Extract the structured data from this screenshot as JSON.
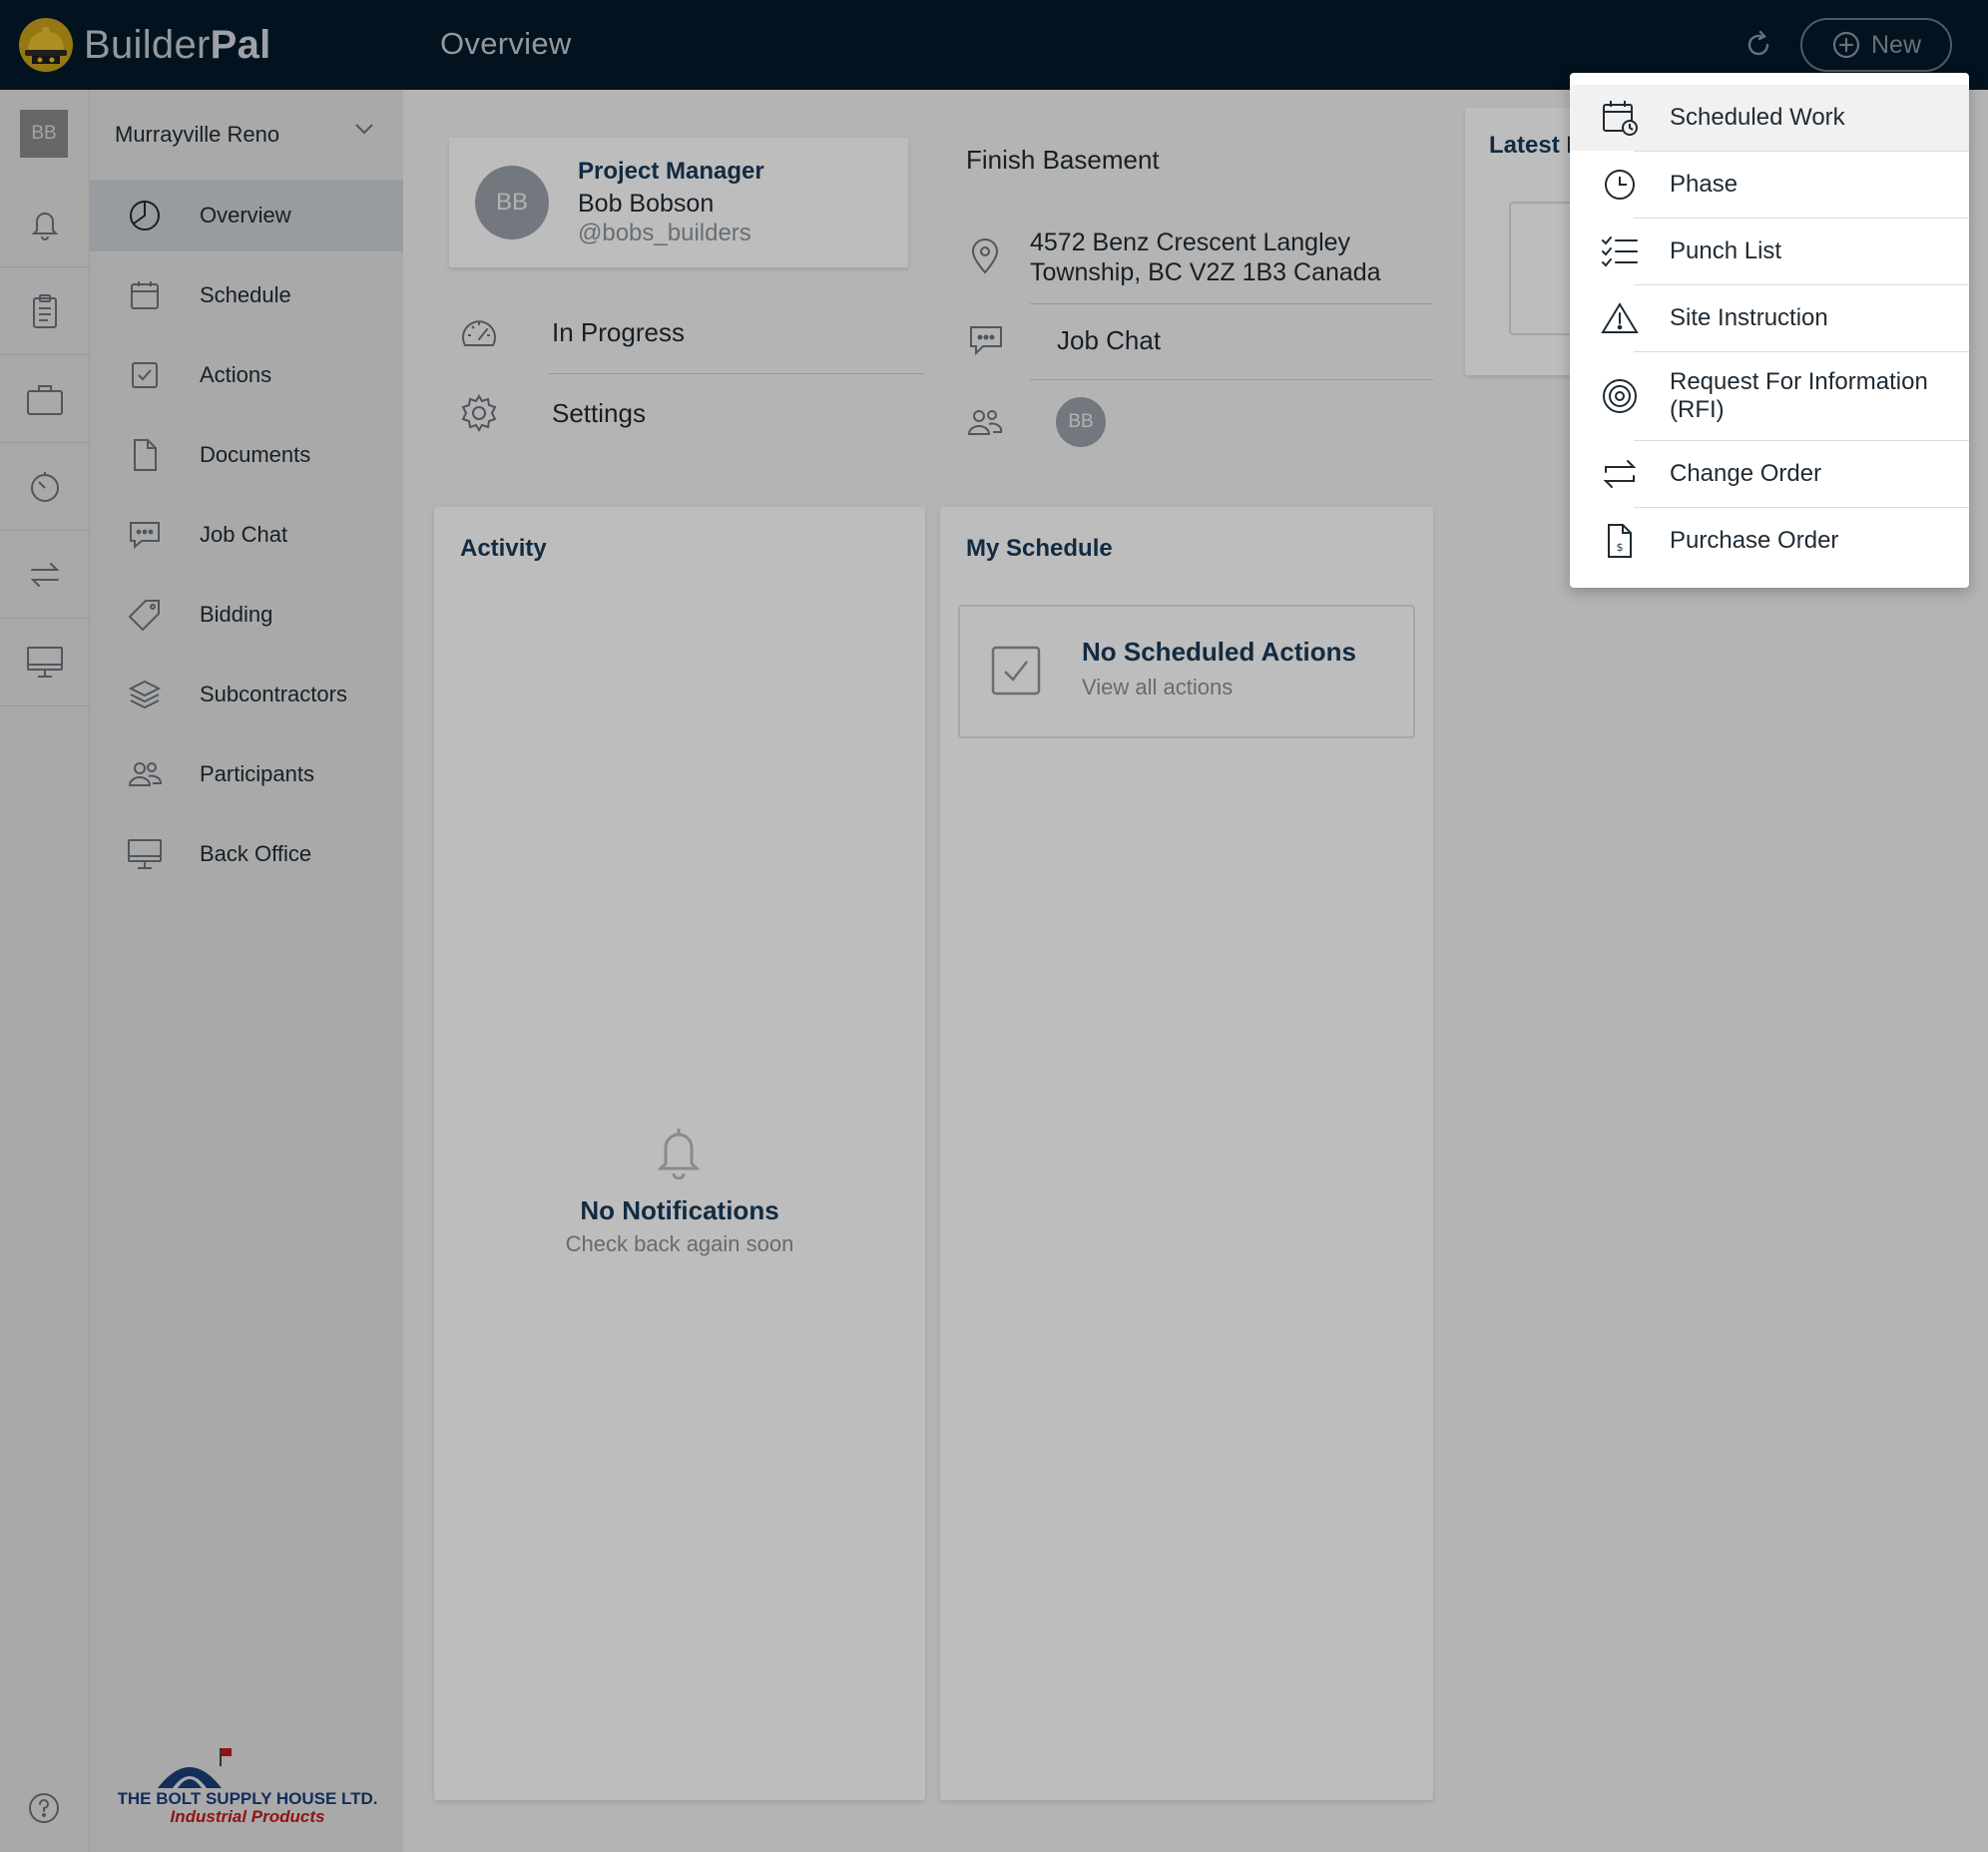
{
  "app": {
    "brand_light": "Builder",
    "brand_bold": "Pal",
    "page_title": "Overview"
  },
  "header": {
    "new_label": "New",
    "refresh_icon": "refresh-icon",
    "new_icon": "plus-circle-icon"
  },
  "user": {
    "initials": "BB"
  },
  "project": {
    "name": "Murrayville Reno"
  },
  "rail": {
    "icons": [
      "bell-icon",
      "clipboard-icon",
      "briefcase-icon",
      "timer-icon",
      "swap-icon",
      "monitor-icon"
    ],
    "help_icon": "help-icon"
  },
  "nav": {
    "items": [
      {
        "label": "Overview",
        "icon": "pie-chart-icon",
        "active": true
      },
      {
        "label": "Schedule",
        "icon": "calendar-icon"
      },
      {
        "label": "Actions",
        "icon": "checkbox-icon"
      },
      {
        "label": "Documents",
        "icon": "document-icon"
      },
      {
        "label": "Job Chat",
        "icon": "chat-icon"
      },
      {
        "label": "Bidding",
        "icon": "tag-icon"
      },
      {
        "label": "Subcontractors",
        "icon": "layers-icon"
      },
      {
        "label": "Participants",
        "icon": "people-icon"
      },
      {
        "label": "Back Office",
        "icon": "monitor-icon"
      }
    ]
  },
  "sponsor": {
    "line1": "THE BOLT SUPPLY HOUSE LTD.",
    "line2": "Industrial Products"
  },
  "overview": {
    "manager": {
      "role": "Project Manager",
      "name": "Bob Bobson",
      "handle": "@bobs_builders",
      "initials": "BB"
    },
    "status_label": "In Progress",
    "settings_label": "Settings",
    "job_title": "Finish Basement",
    "address_line1": "4572 Benz Crescent Langley",
    "address_line2": "Township, BC V2Z 1B3 Canada",
    "job_chat_label": "Job Chat",
    "participant_initials": "BB",
    "latest_label": "Latest D"
  },
  "activity": {
    "title": "Activity",
    "empty_title": "No Notifications",
    "empty_sub": "Check back again soon"
  },
  "schedule": {
    "title": "My Schedule",
    "empty_title": "No Scheduled Actions",
    "empty_sub": "View all actions"
  },
  "menu": {
    "items": [
      {
        "label": "Scheduled Work",
        "icon": "calendar-clock-icon"
      },
      {
        "label": "Phase",
        "icon": "clock-icon"
      },
      {
        "label": "Punch List",
        "icon": "checklist-icon"
      },
      {
        "label": "Site Instruction",
        "icon": "warning-icon"
      },
      {
        "label": "Request For Information",
        "label2": "(RFI)",
        "icon": "target-icon"
      },
      {
        "label": "Change Order",
        "icon": "repeat-icon"
      },
      {
        "label": "Purchase Order",
        "icon": "invoice-icon"
      }
    ]
  },
  "colors": {
    "topbar": "#041a2b",
    "accent": "#173a59",
    "overlay": "rgba(0,0,0,0.26)"
  }
}
